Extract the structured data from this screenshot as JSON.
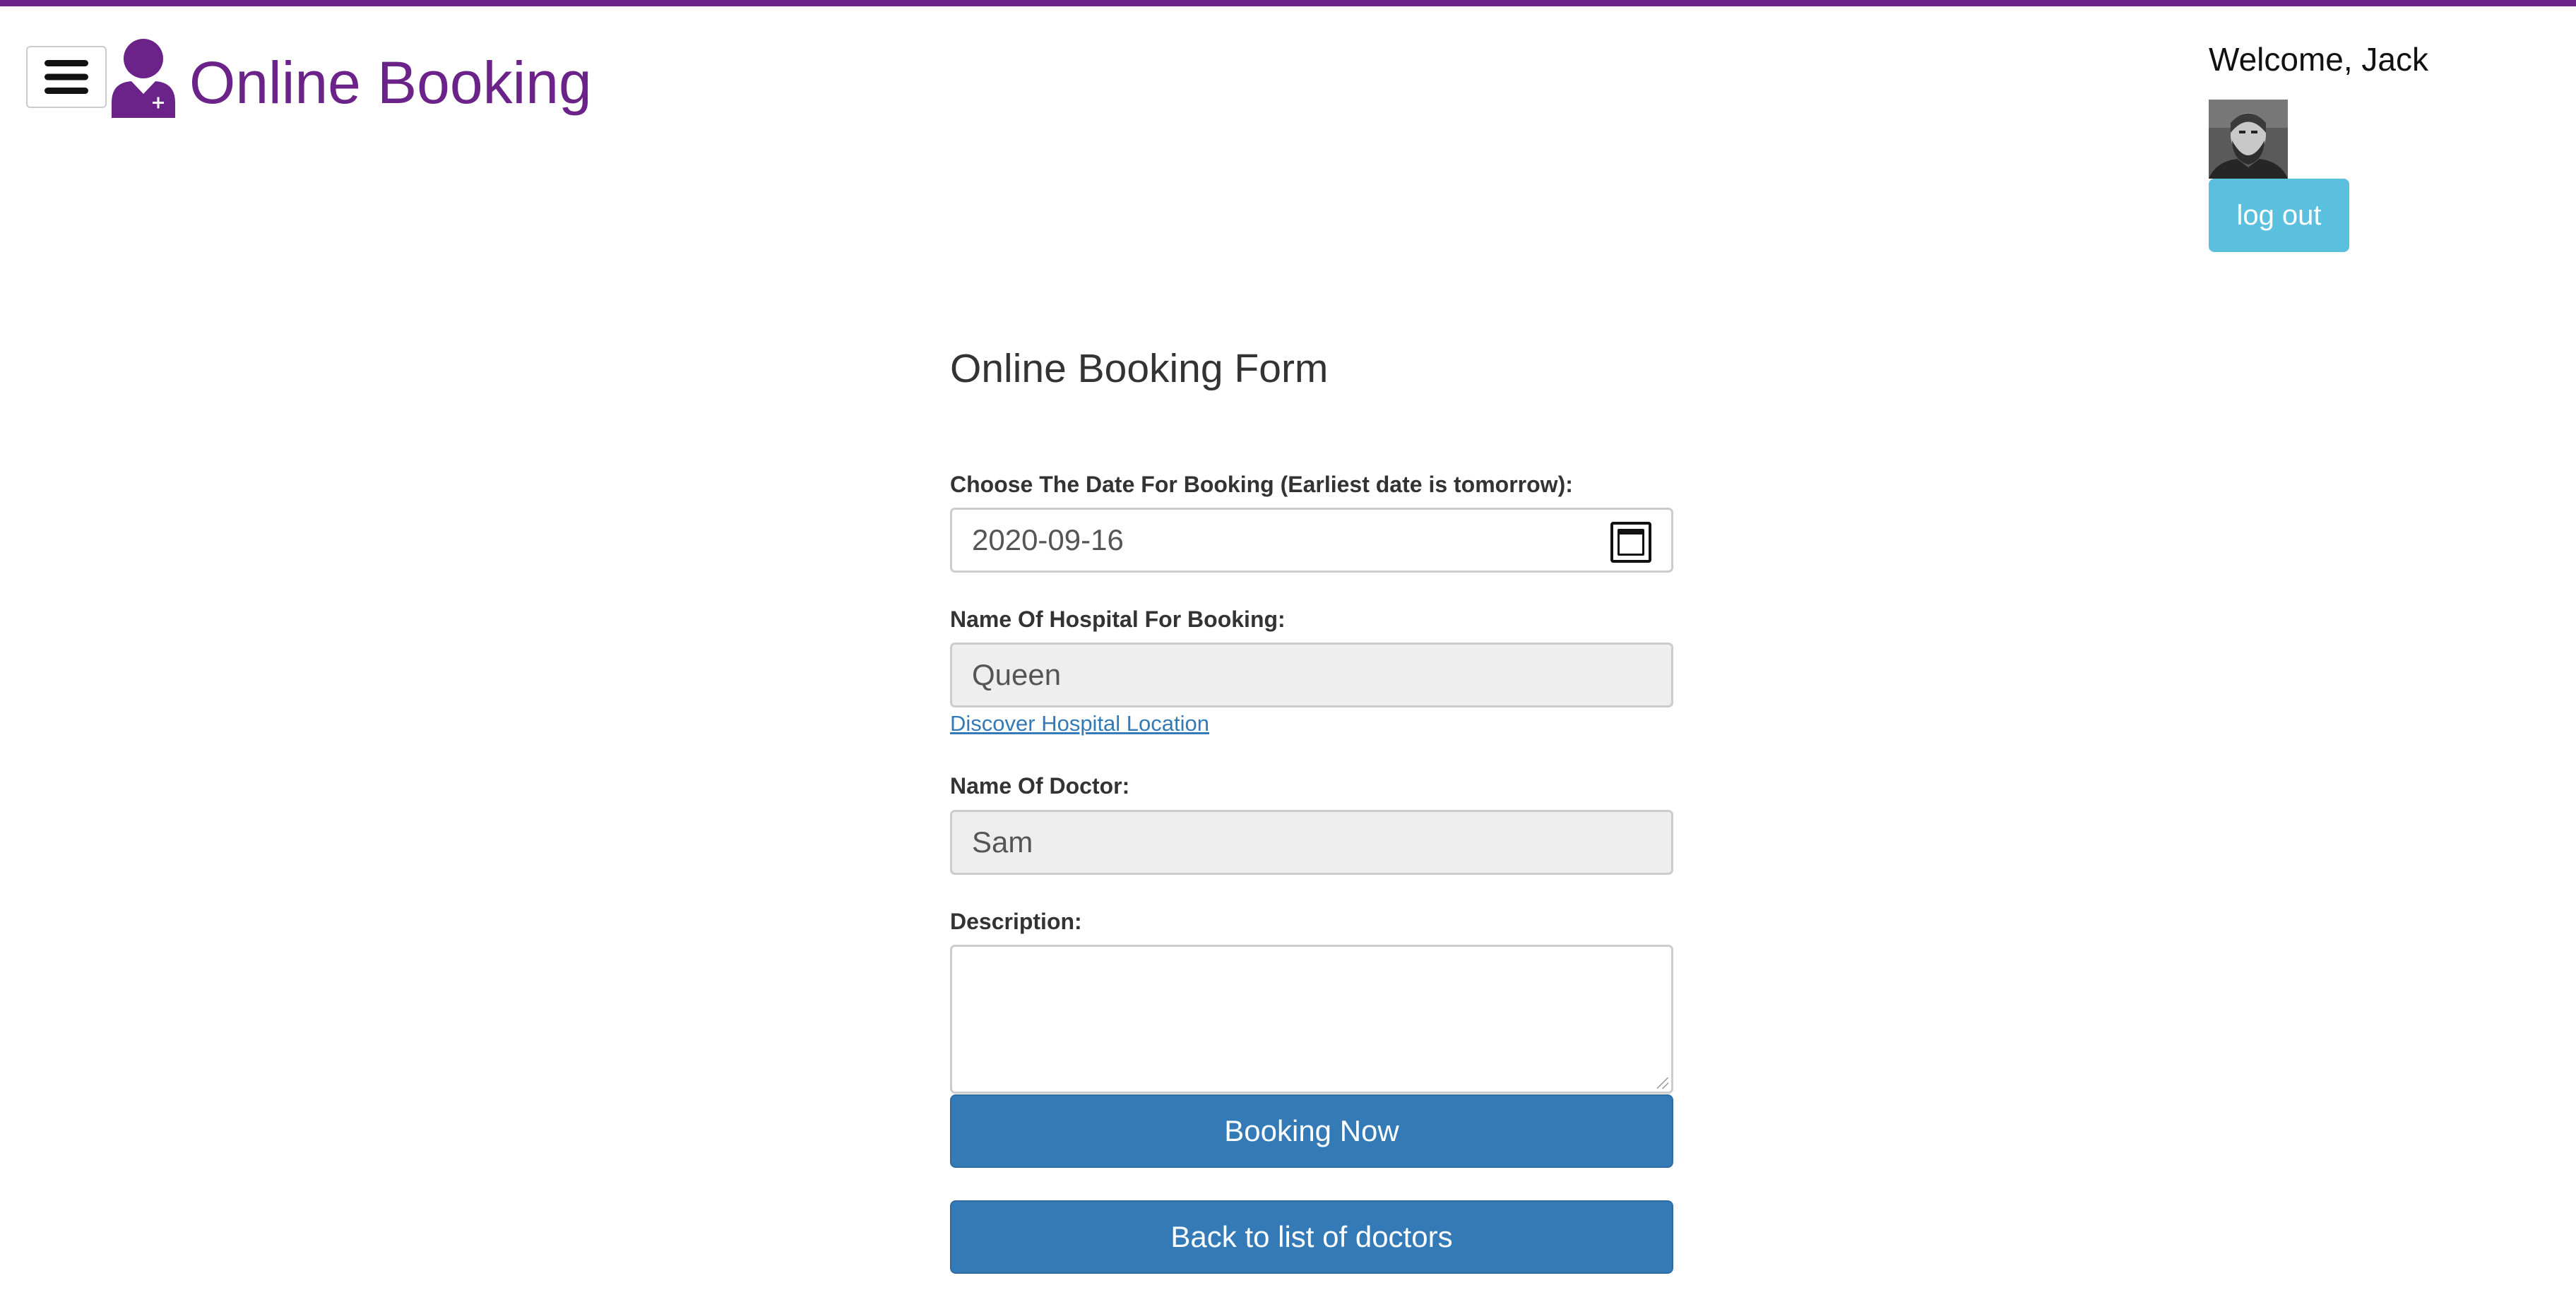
{
  "header": {
    "brand_title": "Online Booking",
    "menu_icon": "hamburger-menu-icon",
    "logo_icon": "doctor-user-icon",
    "brand_color": "#6b2289"
  },
  "user": {
    "welcome_text": "Welcome, Jack",
    "logout_label": "log out"
  },
  "form": {
    "title": "Online Booking Form",
    "date_label": "Choose The Date For Booking (Earliest date is tomorrow):",
    "date_value": "2020-09-16",
    "hospital_label": "Name Of Hospital For Booking:",
    "hospital_value": "Queen",
    "hospital_link": "Discover Hospital Location",
    "doctor_label": "Name Of Doctor:",
    "doctor_value": "Sam",
    "description_label": "Description:",
    "description_value": "",
    "submit_label": "Booking Now",
    "back_label": "Back to list of doctors"
  },
  "colors": {
    "primary": "#337ab7",
    "info": "#5bc0de",
    "accent": "#6b2289"
  }
}
